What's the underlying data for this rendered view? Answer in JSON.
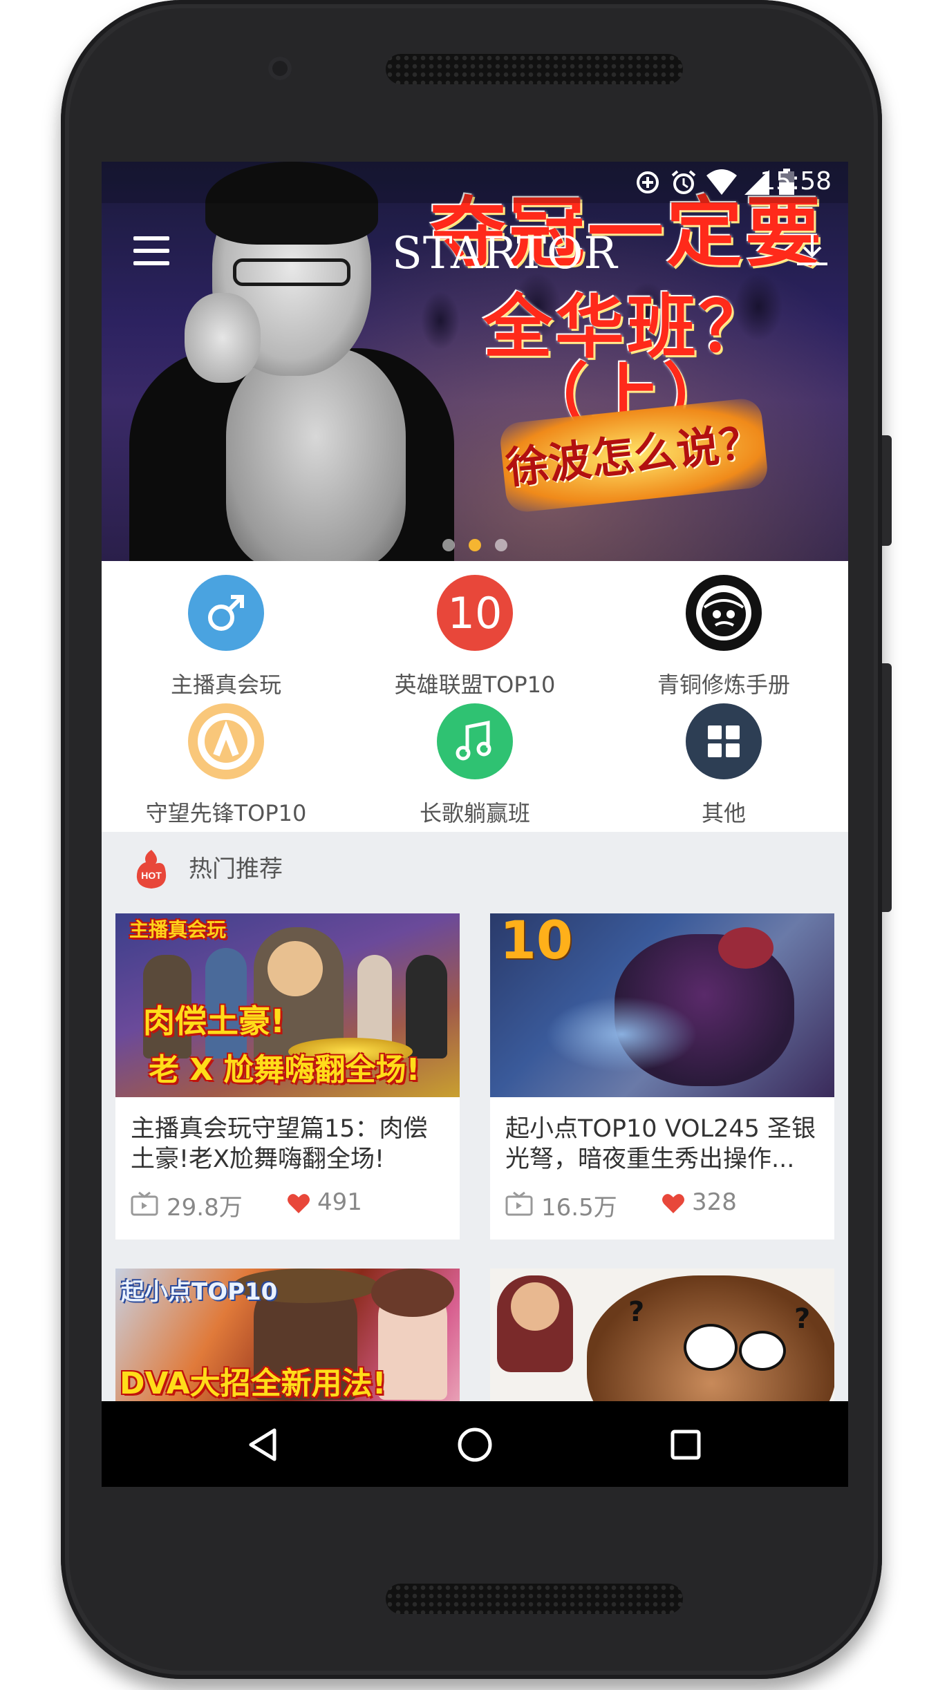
{
  "status_bar": {
    "time": "15:58",
    "icons": [
      "data-saver-icon",
      "alarm-icon",
      "wifi-icon",
      "signal-icon",
      "battery-icon"
    ]
  },
  "app_bar": {
    "logo": "STARTOR",
    "menu_icon": "menu-icon",
    "download_icon": "download-icon"
  },
  "banner": {
    "title_line1": "夺冠一定要",
    "title_line2": "全华班？（上）",
    "badge": "徐波怎么说？",
    "slide_count": 3,
    "active_slide": 2,
    "accent_color": "#f5b531"
  },
  "categories": [
    {
      "label": "主播真会玩",
      "icon": "male-symbol-icon",
      "color": "#4aa3e0"
    },
    {
      "label": "英雄联盟TOP10",
      "icon": "number-10-icon",
      "color": "#e8473a",
      "icon_text": "10"
    },
    {
      "label": "青铜修炼手册",
      "icon": "bronze-face-icon",
      "color": "#111111"
    },
    {
      "label": "守望先锋TOP10",
      "icon": "overwatch-icon",
      "color": "#f9c77a"
    },
    {
      "label": "长歌躺赢班",
      "icon": "music-note-icon",
      "color": "#2fc272"
    },
    {
      "label": "其他",
      "icon": "grid-icon",
      "color": "#2d3e54"
    }
  ],
  "section": {
    "title": "热门推荐",
    "icon": "hot-icon",
    "badge_text": "HOT"
  },
  "videos": [
    {
      "title": "主播真会玩守望篇15：肉偿土豪!老X尬舞嗨翻全场!",
      "views": "29.8万",
      "likes": "491",
      "thumb_top": "主播真会玩",
      "thumb_line1": "肉偿土豪!",
      "thumb_line2": "老 X 尬舞嗨翻全场!"
    },
    {
      "title": "起小点TOP10 VOL245 圣银光弩，暗夜重生秀出操作...",
      "views": "16.5万",
      "likes": "328",
      "thumb_top": "10"
    },
    {
      "title": "",
      "views": "",
      "likes": "",
      "thumb_top": "起小点TOP10",
      "thumb_line1": "DVA大招全新用法!"
    },
    {
      "title": "",
      "views": "",
      "likes": "",
      "thumb_top": ""
    }
  ],
  "nav_bar": {
    "back": "back-triangle-icon",
    "home": "home-circle-icon",
    "recents": "recents-square-icon"
  },
  "colors": {
    "heart": "#e8473a",
    "screen_bg": "#eceef1",
    "navbar": "#000000"
  }
}
